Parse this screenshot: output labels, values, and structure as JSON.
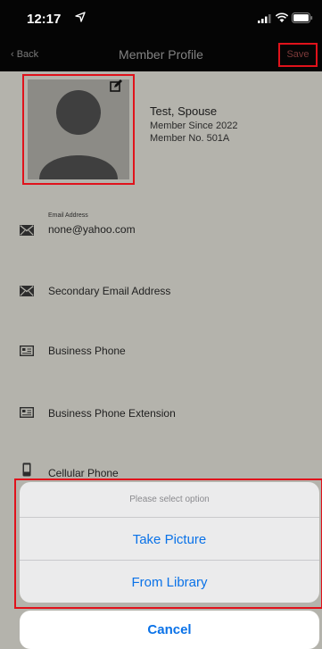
{
  "status_bar": {
    "time": "12:17",
    "location_icon": "location-arrow-icon",
    "signal_icon": "cellular-signal-icon",
    "wifi_icon": "wifi-icon",
    "battery_icon": "battery-icon"
  },
  "nav": {
    "back_label": "‹ Back",
    "title": "Member Profile",
    "save_label": "Save"
  },
  "profile": {
    "name": "Test, Spouse",
    "member_since": "Member Since 2022",
    "member_no": "Member No. 501A"
  },
  "fields": [
    {
      "small_label": "Email Address",
      "value": "none@yahoo.com",
      "icon": "envelope-icon"
    },
    {
      "value": "Secondary Email Address",
      "icon": "envelope-icon"
    },
    {
      "value": "Business Phone",
      "icon": "contact-card-icon"
    },
    {
      "value": "Business Phone Extension",
      "icon": "contact-card-icon"
    },
    {
      "value": "Cellular Phone",
      "icon": "mobile-phone-icon"
    }
  ],
  "action_sheet": {
    "header": "Please select option",
    "take_picture": "Take Picture",
    "from_library": "From Library",
    "cancel": "Cancel"
  },
  "colors": {
    "highlight": "#e0121b",
    "ios_blue": "#0a72e8",
    "dimmed_background": "#b4b3ac"
  }
}
